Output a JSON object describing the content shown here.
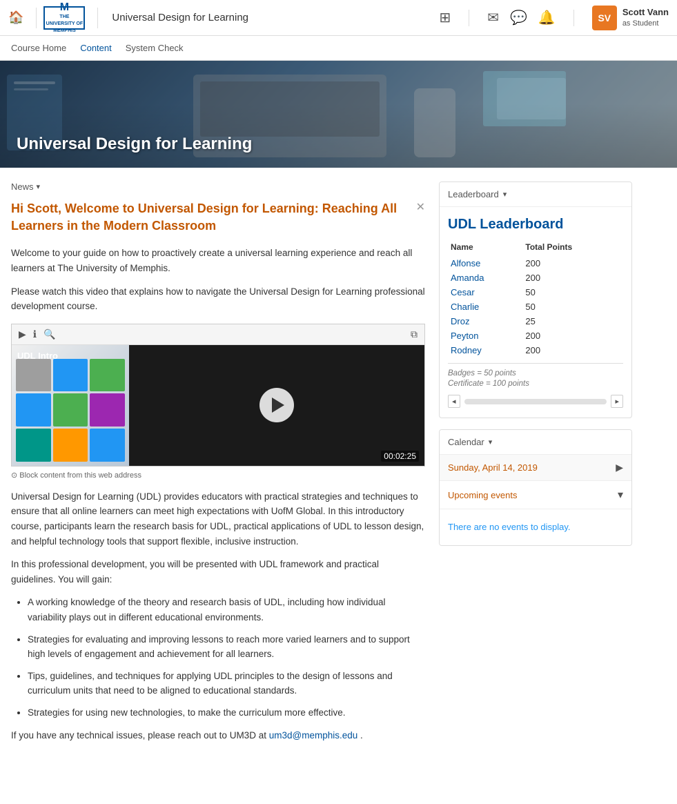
{
  "topnav": {
    "home_icon": "🏠",
    "logo_line1": "THE UNIVERSITY OF",
    "logo_line2": "MEMPHIS",
    "logo_letter": "M",
    "course_title": "Universal Design for Learning",
    "icons": {
      "grid": "⊞",
      "mail": "✉",
      "chat": "💬",
      "bell": "🔔"
    },
    "user": {
      "name": "Scott Vann",
      "role": "as Student",
      "initials": "SV"
    }
  },
  "course_nav": {
    "items": [
      {
        "label": "Course Home",
        "active": false
      },
      {
        "label": "Content",
        "active": true
      },
      {
        "label": "System Check",
        "active": false
      }
    ]
  },
  "banner": {
    "title": "Universal Design for Learning"
  },
  "news": {
    "label": "News",
    "welcome_title": "Hi Scott, Welcome to Universal Design for Learning: Reaching All Learners in the Modern Classroom",
    "intro_p1": "Welcome to your guide on how to proactively create a universal learning experience and reach all learners at The University of Memphis.",
    "intro_p2": "Please watch this video that explains how to navigate the Universal Design for Learning professional development course.",
    "video": {
      "label": "UDL Intro",
      "time": "00:02:25"
    },
    "block_content_caption": "⊙ Block content from this web address",
    "body_p1": "Universal Design for Learning (UDL) provides educators with practical strategies and techniques to ensure that all online learners can meet high expectations with UofM Global. In this introductory course, participants learn the research basis for UDL, practical applications of UDL to lesson design, and helpful technology tools that support flexible, inclusive instruction.",
    "body_p2": "In this professional development, you will be presented with UDL framework and practical guidelines. You will gain:",
    "bullets": [
      "A working knowledge of the theory and research basis of UDL, including how individual variability plays out in different educational environments.",
      "Strategies for evaluating and improving lessons to reach more varied learners and to support high levels of engagement and achievement for all learners.",
      "Tips, guidelines, and techniques for applying UDL principles to the design of lessons and curriculum units that need to be aligned to educational standards.",
      "Strategies for using new technologies, to make the curriculum more effective."
    ],
    "contact_text": "If you have any technical issues, please reach out to UM3D at",
    "contact_email": "um3d@memphis.edu"
  },
  "leaderboard": {
    "header_label": "Leaderboard",
    "title": "UDL Leaderboard",
    "columns": {
      "name": "Name",
      "points": "Total Points"
    },
    "rows": [
      {
        "name": "Alfonse",
        "points": "200"
      },
      {
        "name": "Amanda",
        "points": "200"
      },
      {
        "name": "Cesar",
        "points": "50"
      },
      {
        "name": "Charlie",
        "points": "50"
      },
      {
        "name": "Droz",
        "points": "25"
      },
      {
        "name": "Peyton",
        "points": "200"
      },
      {
        "name": "Rodney",
        "points": "200"
      }
    ],
    "footnote1": "Badges = 50 points",
    "footnote2": "Certificate = 100 points"
  },
  "calendar": {
    "header_label": "Calendar",
    "date": "Sunday, April 14, 2019",
    "upcoming_label": "Upcoming events",
    "no_events": "There are no events to display."
  }
}
